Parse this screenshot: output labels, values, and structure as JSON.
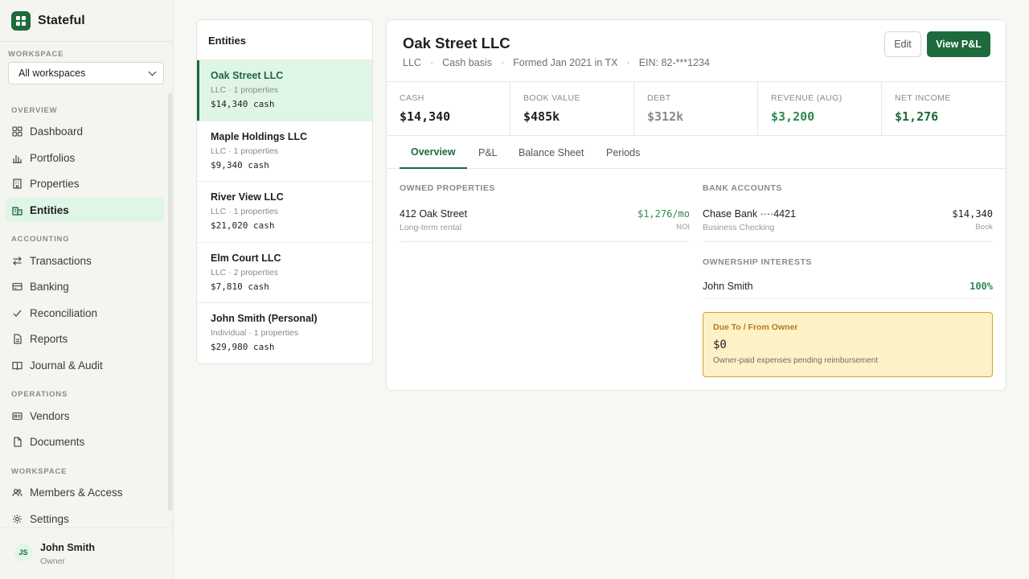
{
  "app": {
    "name": "Stateful",
    "logo_icon": "grid-logo-icon",
    "accent": "#1d6a3d"
  },
  "workspace": {
    "label": "WORKSPACE",
    "selected": "All workspaces"
  },
  "nav": {
    "overview_label": "OVERVIEW",
    "overview": [
      {
        "label": "Dashboard",
        "icon": "dashboard-icon"
      },
      {
        "label": "Portfolios",
        "icon": "bar-chart-icon"
      },
      {
        "label": "Properties",
        "icon": "building-icon"
      },
      {
        "label": "Entities",
        "icon": "entities-icon",
        "active": true
      }
    ],
    "accounting_label": "ACCOUNTING",
    "accounting": [
      {
        "label": "Transactions",
        "icon": "arrows-icon"
      },
      {
        "label": "Banking",
        "icon": "card-icon"
      },
      {
        "label": "Reconciliation",
        "icon": "check-icon"
      },
      {
        "label": "Reports",
        "icon": "file-icon"
      },
      {
        "label": "Journal & Audit",
        "icon": "book-icon"
      }
    ],
    "operations_label": "OPERATIONS",
    "operations": [
      {
        "label": "Vendors",
        "icon": "id-card-icon"
      },
      {
        "label": "Documents",
        "icon": "document-icon"
      }
    ],
    "workspace_label": "WORKSPACE",
    "workspace": [
      {
        "label": "Members & Access",
        "icon": "users-icon"
      },
      {
        "label": "Settings",
        "icon": "gear-icon"
      }
    ]
  },
  "user": {
    "initials": "JS",
    "name": "John Smith",
    "role": "Owner"
  },
  "entities": {
    "title": "Entities",
    "items": [
      {
        "name": "Oak Street LLC",
        "meta": "LLC · 1 properties",
        "cash": "$14,340 cash",
        "active": true
      },
      {
        "name": "Maple Holdings LLC",
        "meta": "LLC · 1 properties",
        "cash": "$9,340 cash"
      },
      {
        "name": "River View LLC",
        "meta": "LLC · 1 properties",
        "cash": "$21,020 cash"
      },
      {
        "name": "Elm Court LLC",
        "meta": "LLC · 2 properties",
        "cash": "$7,810 cash"
      },
      {
        "name": "John Smith (Personal)",
        "meta": "Individual · 1 properties",
        "cash": "$29,980 cash"
      }
    ]
  },
  "detail": {
    "title": "Oak Street LLC",
    "type": "LLC",
    "basis": "Cash basis",
    "formed": "Formed Jan 2021 in TX",
    "ein": "EIN: 82-***1234",
    "edit_label": "Edit",
    "view_pl_label": "View P&L",
    "stats": [
      {
        "label": "CASH",
        "value": "$14,340"
      },
      {
        "label": "BOOK VALUE",
        "value": "$485k"
      },
      {
        "label": "DEBT",
        "value": "$312k"
      },
      {
        "label": "REVENUE (AUG)",
        "value": "$3,200"
      },
      {
        "label": "NET INCOME",
        "value": "$1,276"
      }
    ],
    "tabs": [
      "Overview",
      "P&L",
      "Balance Sheet",
      "Periods"
    ],
    "owned_properties_label": "OWNED PROPERTIES",
    "owned_properties": [
      {
        "name": "412 Oak Street",
        "sub": "Long-term rental",
        "value": "$1,276/mo",
        "value_sub": "NOI"
      }
    ],
    "bank_accounts_label": "BANK ACCOUNTS",
    "bank_accounts": [
      {
        "name": "Chase Bank ····4421",
        "sub": "Business Checking",
        "value": "$14,340",
        "value_sub": "Book"
      }
    ],
    "ownership_label": "OWNERSHIP INTERESTS",
    "ownership": [
      {
        "name": "John Smith",
        "value": "100%"
      }
    ],
    "owner_box": {
      "title": "Due To / From Owner",
      "amount": "$0",
      "note": "Owner-paid expenses pending reimbursement"
    }
  }
}
